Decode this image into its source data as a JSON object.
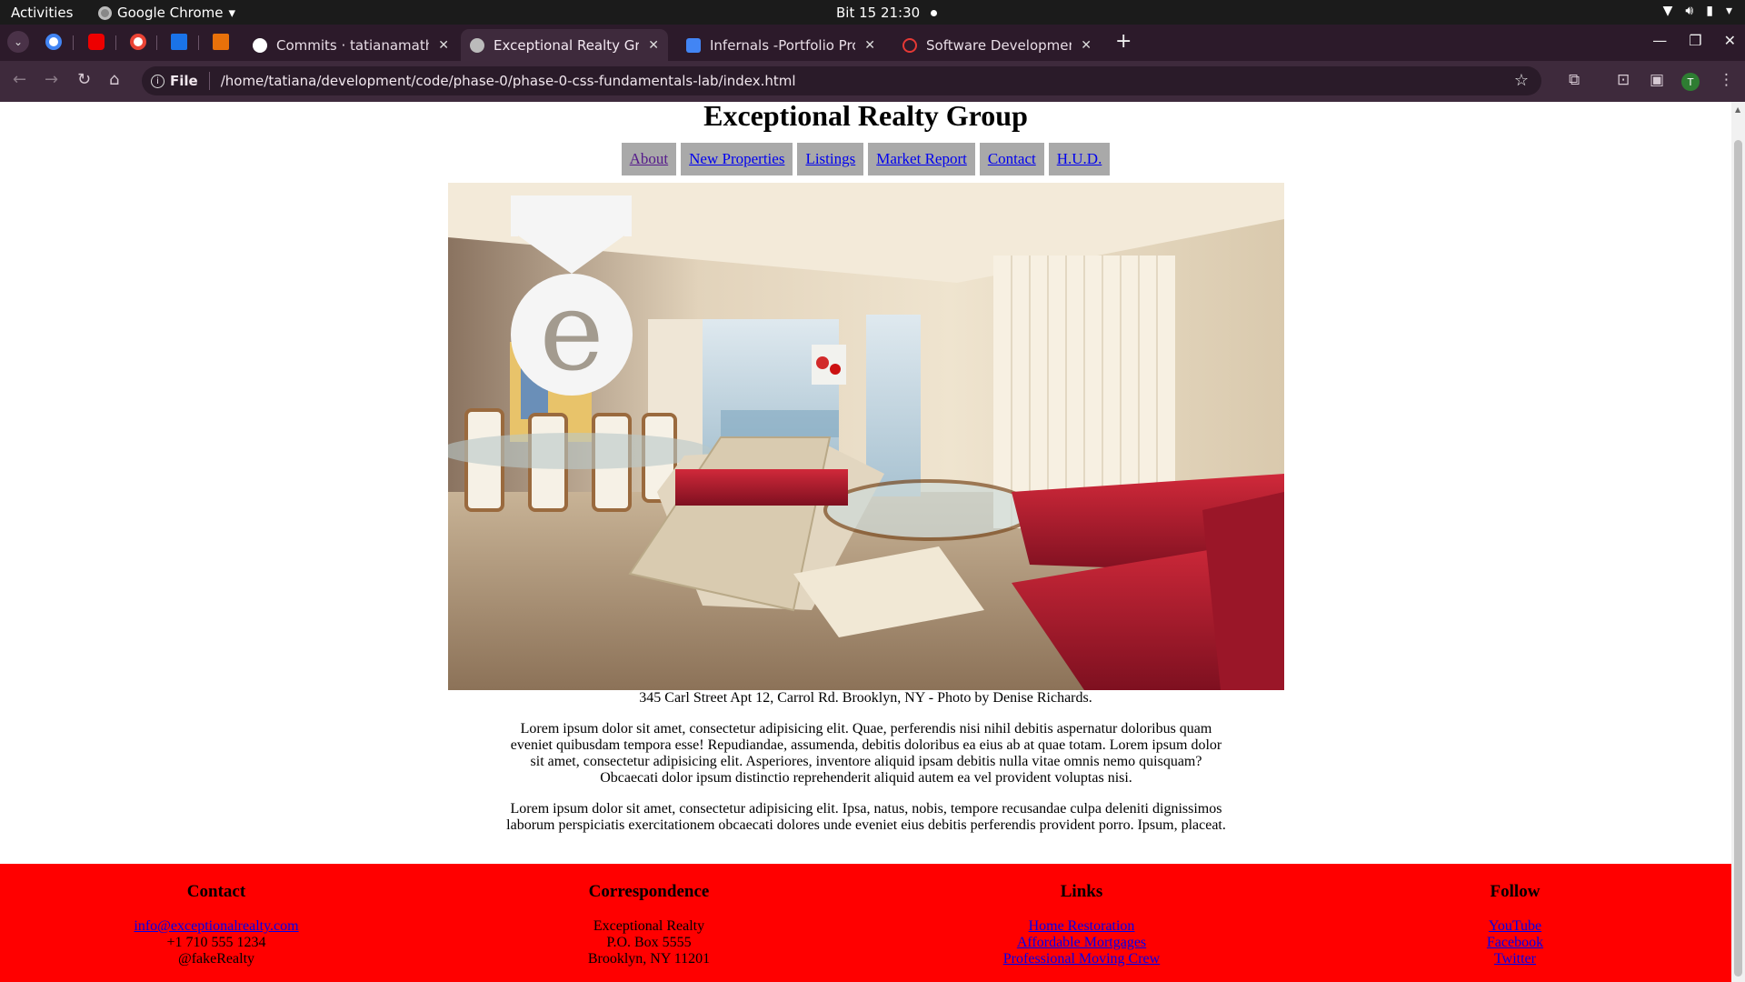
{
  "system": {
    "activities": "Activities",
    "app_name": "Google Chrome",
    "clock": "Bit 15  21:30"
  },
  "browser": {
    "tabs": [
      {
        "title": "Commits · tatianamathia",
        "favicon": "github-icon"
      },
      {
        "title": "Exceptional Realty Group",
        "favicon": "globe-icon"
      },
      {
        "title": "Infernals -Portfolio Proje",
        "favicon": "docs-icon"
      },
      {
        "title": "Software Development I",
        "favicon": "flatiron-icon"
      }
    ],
    "address_scheme": "File",
    "address_url": "/home/tatiana/development/code/phase-0/phase-0-css-fundamentals-lab/index.html",
    "profile_initial": "T"
  },
  "page": {
    "title": "Exceptional Realty Group",
    "nav": [
      "About",
      "New Properties",
      "Listings",
      "Market Report",
      "Contact",
      "H.U.D."
    ],
    "hero_alt": "Living room with red sofa and chaise lounge",
    "caption": "345 Carl Street Apt 12, Carrol Rd. Brooklyn, NY - Photo by Denise Richards.",
    "paragraphs": [
      "Lorem ipsum dolor sit amet, consectetur adipisicing elit. Quae, perferendis nisi nihil debitis aspernatur doloribus quam eveniet quibusdam tempora esse! Repudiandae, assumenda, debitis doloribus ea eius ab at quae totam. Lorem ipsum dolor sit amet, consectetur adipisicing elit. Asperiores, inventore aliquid ipsam debitis nulla vitae omnis nemo quisquam? Obcaecati dolor ipsum distinctio reprehenderit aliquid autem ea vel provident voluptas nisi.",
      "Lorem ipsum dolor sit amet, consectetur adipisicing elit. Ipsa, natus, nobis, tempore recusandae culpa deleniti dignissimos laborum perspiciatis exercitationem obcaecati dolores unde eveniet eius debitis perferendis provident porro. Ipsum, placeat."
    ]
  },
  "footer": {
    "contact": {
      "heading": "Contact",
      "email": "info@exceptionalrealty.com",
      "phone": "+1 710 555 1234",
      "handle": "@fakeRealty"
    },
    "correspondence": {
      "heading": "Correspondence",
      "line1": "Exceptional Realty",
      "line2": "P.O. Box 5555",
      "line3": "Brooklyn, NY 11201"
    },
    "links": {
      "heading": "Links",
      "items": [
        "Home Restoration",
        "Affordable Mortgages",
        "Professional Moving Crew"
      ]
    },
    "follow": {
      "heading": "Follow",
      "items": [
        "YouTube",
        "Facebook",
        "Twitter"
      ]
    }
  },
  "colors": {
    "footer_bg": "#ff0000",
    "nav_bg": "#a9a9a9",
    "link": "#0000ee",
    "visited": "#551a8b"
  }
}
